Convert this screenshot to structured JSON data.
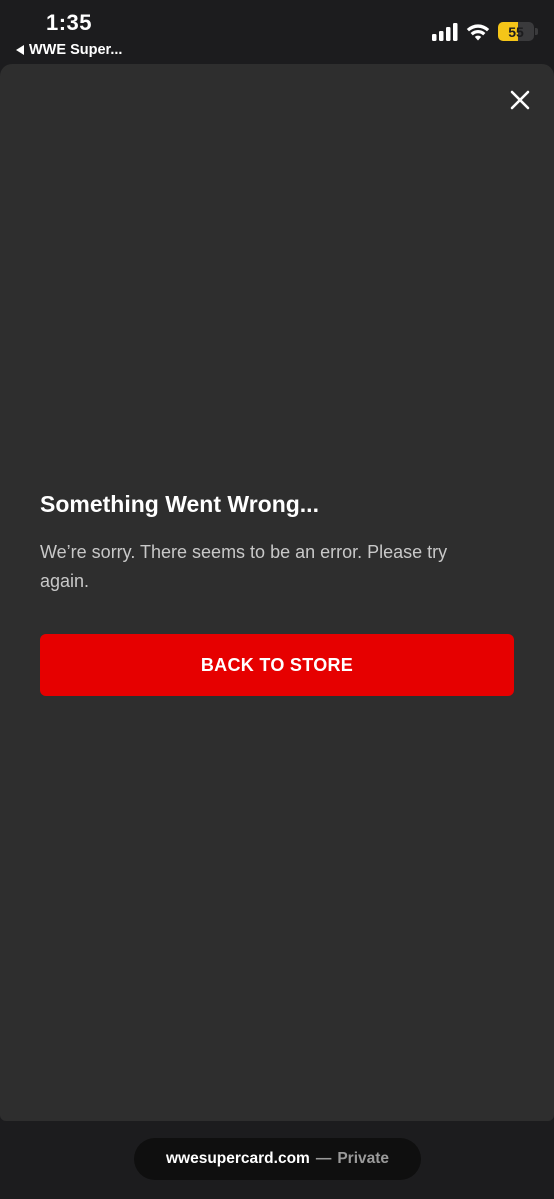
{
  "status_bar": {
    "time": "1:35",
    "back_app_label": "WWE Super...",
    "battery_level": 55,
    "battery_label": "55",
    "battery_color": "#f5c518",
    "icons": [
      "signal-icon",
      "wifi-icon",
      "battery-icon"
    ]
  },
  "sheet": {
    "close_icon": "close-icon",
    "error_title": "Something Went Wrong...",
    "error_message": "We’re sorry. There seems to be an error. Please try again.",
    "back_button_label": "BACK TO STORE",
    "accent_color": "#e60000"
  },
  "url_bar": {
    "domain": "wwesupercard.com",
    "separator": "—",
    "mode": "Private"
  }
}
